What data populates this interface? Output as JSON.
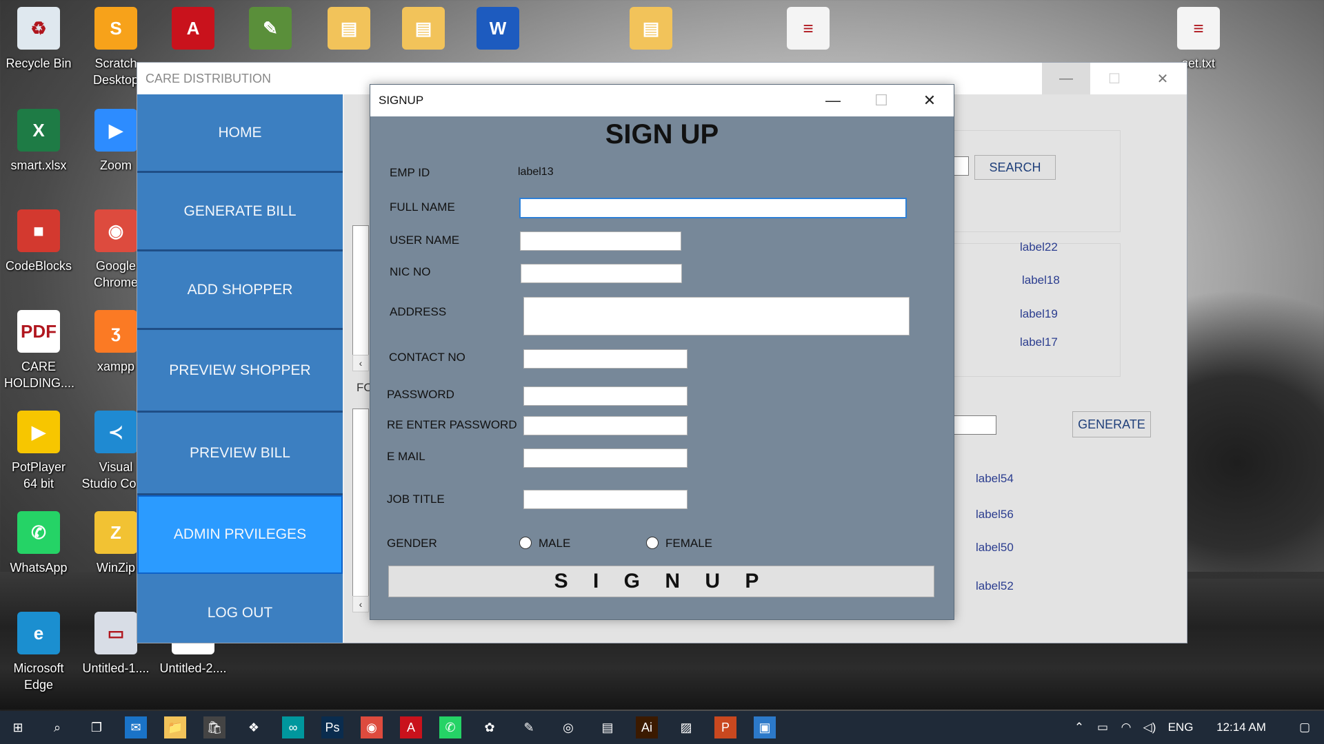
{
  "desktop": {
    "icons": [
      {
        "name": "recycle-bin",
        "label": "Recycle Bin",
        "color": "#dfe8ef",
        "glyph": "♻"
      },
      {
        "name": "scratch-desktop",
        "label": "Scratch Desktop",
        "color": "#f7a21a",
        "glyph": "S"
      },
      {
        "name": "acrobat-reader",
        "label": "",
        "color": "#c9121c",
        "glyph": "A"
      },
      {
        "name": "notepad-app",
        "label": "",
        "color": "#5a8f3a",
        "glyph": "✎"
      },
      {
        "name": "folder-1",
        "label": "",
        "color": "#f2c35a",
        "glyph": "▤"
      },
      {
        "name": "folder-2",
        "label": "",
        "color": "#f2c35a",
        "glyph": "▤"
      },
      {
        "name": "word-doc",
        "label": "",
        "color": "#1d5bbf",
        "glyph": "W"
      },
      {
        "name": "folder-3",
        "label": "",
        "color": "#f2c35a",
        "glyph": "▤"
      },
      {
        "name": "text-file-1",
        "label": "",
        "color": "#f4f4f4",
        "glyph": "≡"
      },
      {
        "name": "text-file-2",
        "label": "set.txt",
        "color": "#f4f4f4",
        "glyph": "≡"
      },
      {
        "name": "smart-xlsx",
        "label": "smart.xlsx",
        "color": "#1e7b45",
        "glyph": "X"
      },
      {
        "name": "zoom-app",
        "label": "Zoom",
        "color": "#2d8cff",
        "glyph": "▶"
      },
      {
        "name": "codeblocks",
        "label": "CodeBlocks",
        "color": "#d3392f",
        "glyph": "■"
      },
      {
        "name": "google-chrome",
        "label": "Google Chrome",
        "color": "#dd4b3e",
        "glyph": "◉"
      },
      {
        "name": "care-holding-pdf",
        "label": "CARE HOLDING....",
        "color": "#ffffff",
        "glyph": "PDF"
      },
      {
        "name": "xampp",
        "label": "xampp",
        "color": "#fb7a24",
        "glyph": "ʒ"
      },
      {
        "name": "potplayer",
        "label": "PotPlayer 64 bit",
        "color": "#f7c600",
        "glyph": "▶"
      },
      {
        "name": "vscode",
        "label": "Visual Studio Code",
        "color": "#1f8ad2",
        "glyph": "≺"
      },
      {
        "name": "whatsapp",
        "label": "WhatsApp",
        "color": "#25d366",
        "glyph": "✆"
      },
      {
        "name": "winzip",
        "label": "WinZip",
        "color": "#f2c233",
        "glyph": "Z"
      },
      {
        "name": "microsoft-edge",
        "label": "Microsoft Edge",
        "color": "#1b8fd0",
        "glyph": "e"
      },
      {
        "name": "untitled-1",
        "label": "Untitled-1....",
        "color": "#d8dde6",
        "glyph": "▭"
      },
      {
        "name": "untitled-2",
        "label": "Untitled-2....",
        "color": "#ffffff",
        "glyph": "▭"
      }
    ]
  },
  "main_window": {
    "title": "CARE DISTRIBUTION",
    "controls": {
      "minimize": "—",
      "maximize": "☐",
      "close": "✕"
    },
    "nav": [
      "HOME",
      "GENERATE BILL",
      "ADD SHOPPER",
      "PREVIEW SHOPPER",
      "PREVIEW BILL",
      "ADMIN PRVILEGES",
      "LOG OUT"
    ],
    "search_button": "SEARCH",
    "generate_button": "GENERATE",
    "fo_label": "FO",
    "labels": [
      "label22",
      "label18",
      "label19",
      "label17",
      "label54",
      "label56",
      "label50",
      "label52"
    ]
  },
  "signup": {
    "title": "SIGNUP",
    "heading": "SIGN UP",
    "controls": {
      "minimize": "—",
      "maximize": "☐",
      "close": "✕"
    },
    "emp_id_label": "EMP ID",
    "emp_id_value": "label13",
    "fields": {
      "full_name": "FULL NAME",
      "user_name": "USER NAME",
      "nic_no": "NIC NO",
      "address": "ADDRESS",
      "contact_no": "CONTACT NO",
      "password": "PASSWORD",
      "re_enter_password": "RE ENTER  PASSWORD",
      "email": "E MAIL",
      "job_title": "JOB TITLE",
      "gender": "GENDER"
    },
    "gender_options": {
      "male": "MALE",
      "female": "FEMALE"
    },
    "submit": "S I G N   U P"
  },
  "taskbar": {
    "icons": [
      "windows-start-icon",
      "search-icon",
      "task-view-icon",
      "mail-icon",
      "file-explorer-icon",
      "store-icon",
      "dropbox-icon",
      "arduino-icon",
      "photoshop-icon",
      "chrome-icon",
      "acrobat-icon",
      "whatsapp-icon",
      "paint-icon",
      "notepad-icon",
      "media-player-icon",
      "scanner-icon",
      "illustrator-icon",
      "photos-icon",
      "powerpoint-icon",
      "app-window-icon"
    ],
    "language": "ENG",
    "time": "12:14 AM"
  }
}
